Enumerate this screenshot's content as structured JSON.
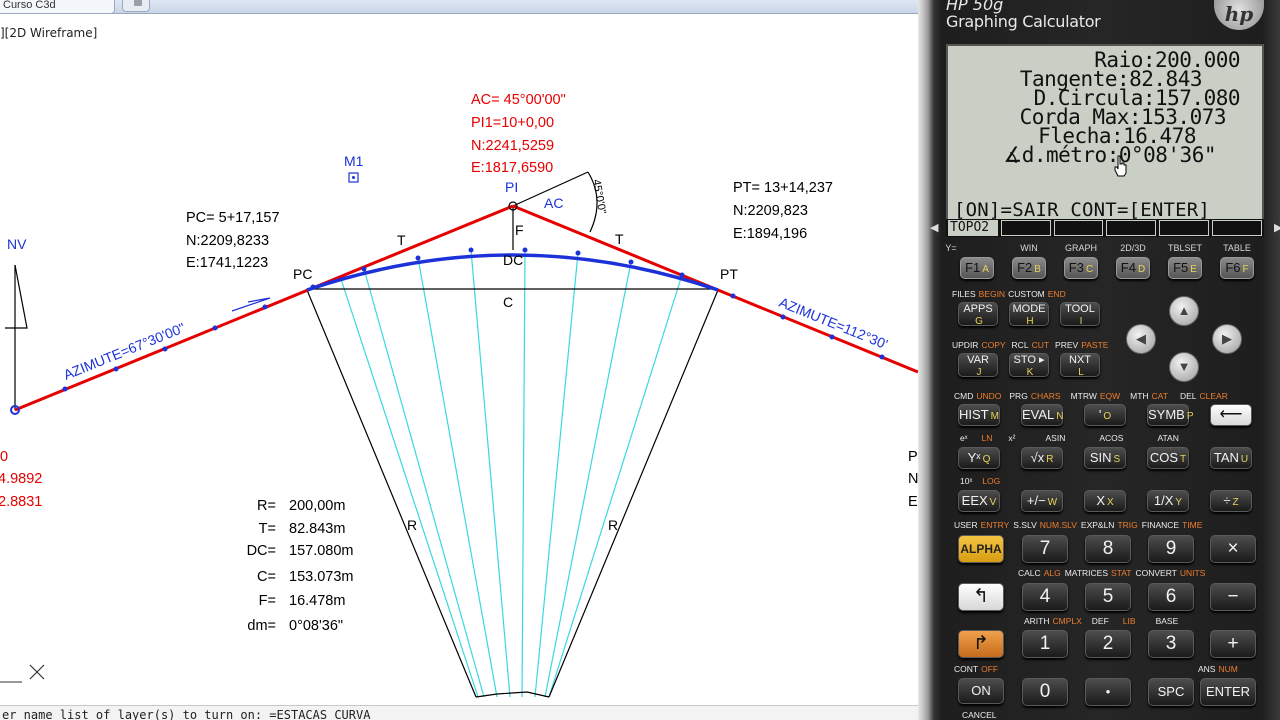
{
  "cad": {
    "tab_title": "Curso C3d",
    "viewport_label": "][2D Wireframe]",
    "command_line": "er name list of layer(s) to turn on: =ESTACAS CURVA",
    "drawing_labels": {
      "pi_ac": "AC=  45°00'00\"",
      "pi_station": "PI1=10+0,00",
      "pi_n": "N:2241,5259",
      "pi_e": "E:1817,6590",
      "pi": "PI",
      "ac": "AC",
      "angle": "45°0'0\"",
      "pc_station": "PC=  5+17,157",
      "pc_n": "N:2209,8233",
      "pc_e": "E:1741,1223",
      "pt_station": "PT=  13+14,237",
      "pt_n": "N:2209,823",
      "pt_e": "E:1894,196",
      "m1": "M1",
      "nv": "NV",
      "pc": "PC",
      "pt": "PT",
      "dc": "DC",
      "c": "C",
      "f": "F",
      "t_left": "T",
      "t_right": "T",
      "r_left": "R",
      "r_right": "R",
      "azimuth_left": "AZIMUTE=67°30'00\"",
      "azimuth_right": "AZIMUTE=112°30'",
      "left_cut_0": "0",
      "left_cut_1": "4.9892",
      "left_cut_2": "2.8831",
      "right_cut_0": "P",
      "right_cut_1": "N",
      "right_cut_2": "E"
    },
    "summary": [
      {
        "label": "R=",
        "value": "200,00m"
      },
      {
        "label": "T=",
        "value": "82.843m"
      },
      {
        "label": "DC=",
        "value": "157.080m"
      },
      {
        "label": "C=",
        "value": "153.073m"
      },
      {
        "label": "F=",
        "value": "16.478m"
      },
      {
        "label": "dm=",
        "value": "0°08'36\""
      }
    ]
  },
  "calculator": {
    "model": "HP 50g",
    "subtitle": "Graphing Calculator",
    "logo": "hp",
    "screen_lines": [
      "Raio:200.000",
      "Tangente:82.843",
      "D.Circula:157.080",
      "Corda Max:153.073",
      "Flecha:16.478",
      "∡d.métro:0°08'36\""
    ],
    "prompt": "[ON]=SAIR CONT=[ENTER]",
    "softkeys": [
      "TOPO2",
      "",
      "",
      "",
      "",
      ""
    ],
    "fkeys": [
      {
        "top": "Y=",
        "label": "F1",
        "alpha": "A"
      },
      {
        "top": "WIN",
        "label": "F2",
        "alpha": "B"
      },
      {
        "top": "GRAPH",
        "label": "F3",
        "alpha": "C"
      },
      {
        "top": "2D/3D",
        "label": "F4",
        "alpha": "D"
      },
      {
        "top": "TBLSET",
        "label": "F5",
        "alpha": "E"
      },
      {
        "top": "TABLE",
        "label": "F6",
        "alpha": "F"
      }
    ],
    "keys": {
      "apps": "APPS",
      "apps_a": "G",
      "mode": "MODE",
      "mode_a": "H",
      "tool": "TOOL",
      "tool_a": "I",
      "var": "VAR",
      "var_a": "J",
      "sto": "STO ▸",
      "sto_a": "K",
      "nxt": "NXT",
      "nxt_a": "L",
      "hist": "HIST",
      "hist_a": "M",
      "eval": "EVAL",
      "eval_a": "N",
      "quote": "'",
      "quote_a": "O",
      "symb": "SYMB",
      "symb_a": "P",
      "del": "⟵",
      "yx": "Yˣ",
      "yx_a": "Q",
      "sqrt": "√x",
      "sqrt_a": "R",
      "sin": "SIN",
      "sin_a": "S",
      "cos": "COS",
      "cos_a": "T",
      "tan": "TAN",
      "tan_a": "U",
      "eex": "EEX",
      "eex_a": "V",
      "neg": "+/−",
      "neg_a": "W",
      "x": "X",
      "x_a": "X",
      "inv": "1/X",
      "inv_a": "Y",
      "div": "÷",
      "div_a": "Z",
      "alpha": "ALPHA",
      "n7": "7",
      "n8": "8",
      "n9": "9",
      "mul": "×",
      "lshift": "↰",
      "n4": "4",
      "n5": "5",
      "n6": "6",
      "minus": "−",
      "rshift": "↱",
      "n1": "1",
      "n2": "2",
      "n3": "3",
      "plus": "+",
      "on": "ON",
      "n0": "0",
      "dot": "•",
      "spc": "SPC",
      "enter": "ENTER"
    },
    "shift_labels": {
      "files": "FILES",
      "begin": "BEGIN",
      "custom": "CUSTOM",
      "end": "END",
      "updir": "UPDIR",
      "copy": "COPY",
      "rcl": "RCL",
      "cut": "CUT",
      "prev": "PREV",
      "paste": "PASTE",
      "cmd": "CMD",
      "undo": "UNDO",
      "prg": "PRG",
      "chars": "CHARS",
      "mtrw": "MTRW",
      "eqw": "EQW",
      "mth": "MTH",
      "cat": "CAT",
      "del": "DEL",
      "clear": "CLEAR",
      "ex": "eˣ",
      "ln": "LN",
      "x2": "x²",
      "asin": "ASIN",
      "acos": "ACOS",
      "atan": "ATAN",
      "tenx": "10ˣ",
      "log": "LOG",
      "user": "USER",
      "entry": "ENTRY",
      "sslv": "S.SLV",
      "numslv": "NUM.SLV",
      "explin": "EXP&LN",
      "trig": "TRIG",
      "finance": "FINANCE",
      "time": "TIME",
      "calc": "CALC",
      "alg": "ALG",
      "matrices": "MATRICES",
      "stat": "STAT",
      "convert": "CONVERT",
      "units": "UNITS",
      "arith": "ARITH",
      "cmplx": "CMPLX",
      "def": "DEF",
      "lib": "LIB",
      "base": "BASE",
      "cont": "CONT",
      "off": "OFF",
      "ans": "ANS",
      "num": "NUM",
      "cancel": "CANCEL"
    }
  }
}
